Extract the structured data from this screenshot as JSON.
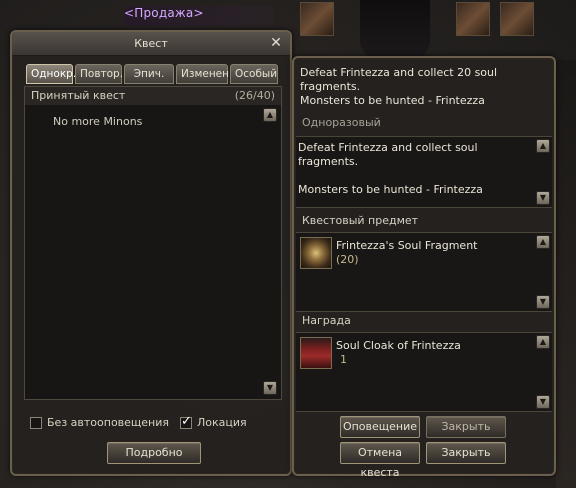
{
  "scene": {
    "shop_tag": "<Продажа>"
  },
  "quest_window": {
    "title": "Квест",
    "close_glyph": "✕",
    "tabs": [
      {
        "label": "Однокр.",
        "active": true
      },
      {
        "label": "Повтор.",
        "active": false
      },
      {
        "label": "Эпич.",
        "active": false
      },
      {
        "label": "Изменен.",
        "active": false
      },
      {
        "label": "Особый",
        "active": false
      }
    ],
    "list": {
      "header": "Принятый квест",
      "count": "(26/40)",
      "empty_text": "No more Minons"
    },
    "options": {
      "no_auto_alert": {
        "label": "Без автооповещения",
        "checked": false
      },
      "location": {
        "label": "Локация",
        "checked": true
      }
    },
    "details_button": "Подробно"
  },
  "detail_window": {
    "title_line1": "Defeat Frintezza and collect 20 soul fragments.",
    "title_line2": "Monsters to be hunted - Frintezza",
    "type": "Одноразовый",
    "description_line1": "Defeat Frintezza and collect soul fragments.",
    "description_line2": "Monsters to be hunted - Frintezza",
    "quest_item_label": "Квестовый предмет",
    "quest_item": {
      "name": "Frintezza's Soul Fragment",
      "qty": "(20)",
      "icon": "soul-fragment-icon"
    },
    "reward_label": "Награда",
    "reward_item": {
      "name": "Soul Cloak of Frintezza",
      "qty": "1",
      "icon": "cloak-icon"
    },
    "buttons": {
      "notify": "Оповещение",
      "close_top": "Закрыть",
      "abandon": "Отмена квеста",
      "close_bottom": "Закрыть"
    }
  },
  "colors": {
    "frame": "#6a5f4c",
    "text": "#d8d2c4",
    "shop_tag": "#d6a9ff"
  }
}
